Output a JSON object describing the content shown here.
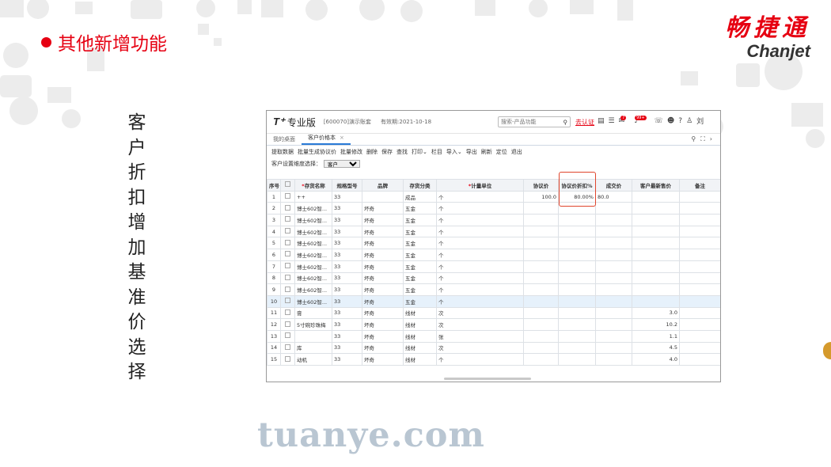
{
  "slide": {
    "title": "其他新增功能",
    "logo_cn": "畅捷通",
    "logo_en": "Chanjet",
    "vertical_text": [
      "客",
      "户",
      "折",
      "扣",
      "增",
      "加",
      "基",
      "准",
      "价",
      "选",
      "择"
    ],
    "watermark": "tuanye.com",
    "accent_color": "#e60012"
  },
  "app": {
    "brand": "T⁺",
    "edition": "专业版",
    "account": "[600070]演示账套",
    "valid_until": "有效期:2021-10-18",
    "search_placeholder": "搜索-产品功能",
    "certify": "去认证",
    "badge1": "7",
    "badge2": "99+",
    "user": "刘",
    "tabs": [
      {
        "label": "我的桌面"
      },
      {
        "label": "客户价格本",
        "close": "×"
      }
    ],
    "toolbar": [
      "提取数据",
      "批量生成协议价",
      "批量修改",
      "删除",
      "保存",
      "查找",
      "打印⌄",
      "栏目",
      "导入⌄",
      "导出",
      "刷新",
      "定位",
      "退出"
    ],
    "filter_label": "客户设置维度选择：",
    "filter_value": "客户",
    "columns": [
      "序号",
      "",
      "存货名称",
      "规格型号",
      "品牌",
      "存货分类",
      "计量单位",
      "协议价",
      "协议价折扣%",
      "成交价",
      "客户最新售价",
      "备注"
    ],
    "rows": [
      [
        "1",
        "",
        "++",
        "33",
        "",
        "成品",
        "个",
        "100.0",
        "80.00%",
        "80.0",
        "",
        ""
      ],
      [
        "2",
        "",
        "博士602智...",
        "33",
        "坏奇",
        "五金",
        "个",
        "",
        "",
        "",
        "",
        ""
      ],
      [
        "3",
        "",
        "博士602智...",
        "33",
        "坏奇",
        "五金",
        "个",
        "",
        "",
        "",
        "",
        ""
      ],
      [
        "4",
        "",
        "博士602智...",
        "33",
        "坏奇",
        "五金",
        "个",
        "",
        "",
        "",
        "",
        ""
      ],
      [
        "5",
        "",
        "博士602智...",
        "33",
        "坏奇",
        "五金",
        "个",
        "",
        "",
        "",
        "",
        ""
      ],
      [
        "6",
        "",
        "博士602智...",
        "33",
        "坏奇",
        "五金",
        "个",
        "",
        "",
        "",
        "",
        ""
      ],
      [
        "7",
        "",
        "博士602智...",
        "33",
        "坏奇",
        "五金",
        "个",
        "",
        "",
        "",
        "",
        ""
      ],
      [
        "8",
        "",
        "博士602智...",
        "33",
        "坏奇",
        "五金",
        "个",
        "",
        "",
        "",
        "",
        ""
      ],
      [
        "9",
        "",
        "博士602智...",
        "33",
        "坏奇",
        "五金",
        "个",
        "",
        "",
        "",
        "",
        ""
      ],
      [
        "10",
        "",
        "博士602智...",
        "33",
        "坏奇",
        "五金",
        "个",
        "",
        "",
        "",
        "",
        ""
      ],
      [
        "11",
        "",
        "膏",
        "33",
        "坏奇",
        "线材",
        "次",
        "",
        "",
        "",
        "3.0",
        ""
      ],
      [
        "12",
        "",
        "5寸碗珍珠梅",
        "33",
        "坏奇",
        "线材",
        "次",
        "",
        "",
        "",
        "10.2",
        ""
      ],
      [
        "13",
        "",
        "",
        "33",
        "坏奇",
        "线材",
        "张",
        "",
        "",
        "",
        "1.1",
        ""
      ],
      [
        "14",
        "",
        "库",
        "33",
        "坏奇",
        "线材",
        "次",
        "",
        "",
        "",
        "4.5",
        ""
      ],
      [
        "15",
        "",
        "动机",
        "33",
        "坏奇",
        "线材",
        "个",
        "",
        "",
        "",
        "4.0",
        ""
      ]
    ]
  }
}
